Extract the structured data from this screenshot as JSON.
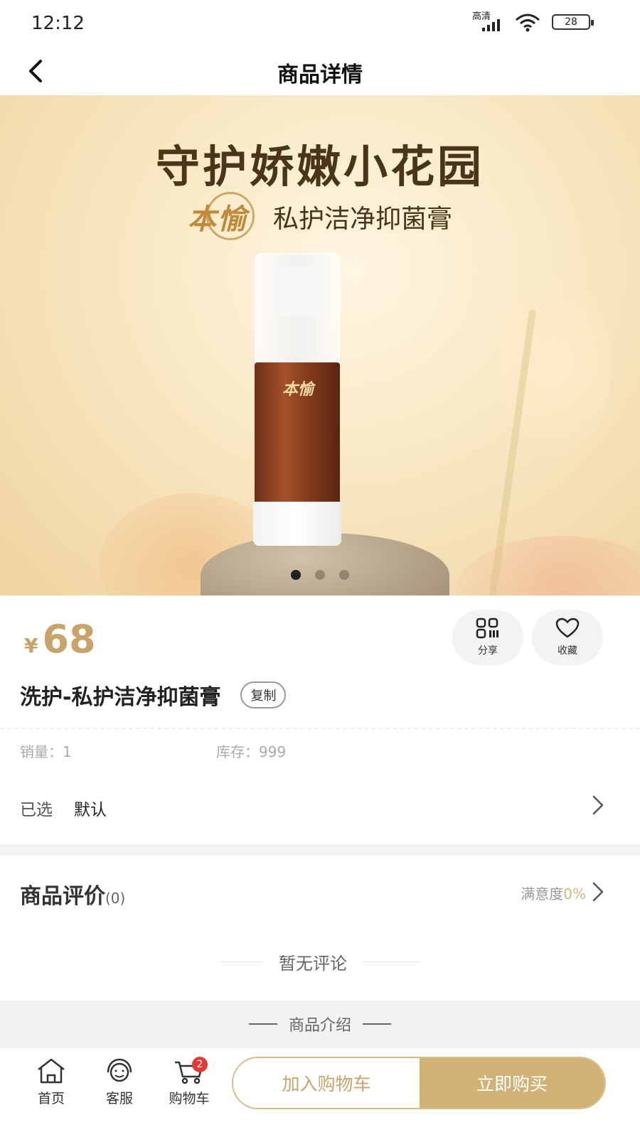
{
  "status_bar": {
    "time": "12:12",
    "hd_label": "高清",
    "battery": "28"
  },
  "header": {
    "title": "商品详情"
  },
  "hero": {
    "headline": "守护娇嫩小花园",
    "brand": "本愉",
    "subtitle": "私护洁净抑菌膏",
    "bottle_brand": "本愉",
    "slides_total": 3,
    "slide_active": 1
  },
  "product": {
    "currency": "¥",
    "price": "68",
    "name": "洗护-私护洁净抑菌膏",
    "copy_label": "复制",
    "share_label": "分享",
    "favorite_label": "收藏",
    "sales": "销量：1",
    "stock": "库存：999",
    "selected_label": "已选",
    "selected_value": "默认"
  },
  "reviews": {
    "title": "商品评价",
    "count": "(0)",
    "satisfaction_label": "满意度",
    "satisfaction_value": "0%",
    "empty_text": "暂无评论"
  },
  "intro": {
    "label": "商品介绍"
  },
  "bottom_bar": {
    "home_label": "首页",
    "service_label": "客服",
    "cart_label": "购物车",
    "cart_badge": "2",
    "add_to_cart": "加入购物车",
    "buy_now": "立即购买"
  },
  "colors": {
    "accent_gold": "#c9a46a",
    "buy_button": "#d2b177",
    "badge_red": "#e53935"
  }
}
